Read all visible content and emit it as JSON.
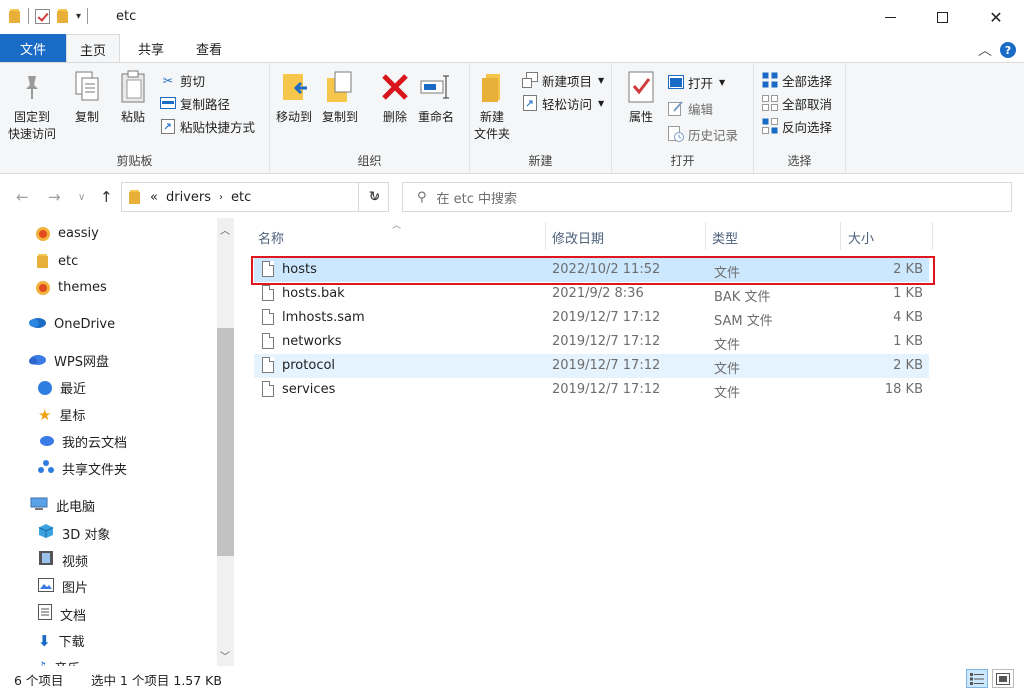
{
  "window": {
    "title": "etc"
  },
  "tabs": {
    "file": "文件",
    "home": "主页",
    "share": "共享",
    "view": "查看"
  },
  "ribbon": {
    "clipboard": {
      "label": "剪贴板",
      "pin": "固定到\n快速访问",
      "pin_l1": "固定到",
      "pin_l2": "快速访问",
      "copy": "复制",
      "paste": "粘贴",
      "cut": "剪切",
      "copy_path": "复制路径",
      "paste_shortcut": "粘贴快捷方式"
    },
    "organize": {
      "label": "组织",
      "move_to": "移动到",
      "copy_to": "复制到",
      "delete": "删除",
      "rename": "重命名"
    },
    "new": {
      "label": "新建",
      "new_folder_l1": "新建",
      "new_folder_l2": "文件夹",
      "new_item": "新建项目",
      "easy_access": "轻松访问"
    },
    "open": {
      "label": "打开",
      "properties": "属性",
      "open": "打开",
      "edit": "编辑",
      "history": "历史记录"
    },
    "select": {
      "label": "选择",
      "select_all": "全部选择",
      "select_none": "全部取消",
      "invert": "反向选择"
    }
  },
  "address": {
    "prefix": "«",
    "segments": [
      "drivers",
      "etc"
    ],
    "search_placeholder": "在 etc 中搜索"
  },
  "nav": {
    "items": [
      {
        "label": "eassiy"
      },
      {
        "label": "etc"
      },
      {
        "label": "themes"
      },
      {
        "label": "OneDrive"
      },
      {
        "label": "WPS网盘"
      },
      {
        "label": "最近"
      },
      {
        "label": "星标"
      },
      {
        "label": "我的云文档"
      },
      {
        "label": "共享文件夹"
      },
      {
        "label": "此电脑"
      },
      {
        "label": "3D 对象"
      },
      {
        "label": "视频"
      },
      {
        "label": "图片"
      },
      {
        "label": "文档"
      },
      {
        "label": "下载"
      },
      {
        "label": "音乐"
      }
    ]
  },
  "columns": {
    "name": "名称",
    "date": "修改日期",
    "type": "类型",
    "size": "大小"
  },
  "files": [
    {
      "name": "hosts",
      "date": "2022/10/2 11:52",
      "type": "文件",
      "size": "2 KB"
    },
    {
      "name": "hosts.bak",
      "date": "2021/9/2 8:36",
      "type": "BAK 文件",
      "size": "1 KB"
    },
    {
      "name": "lmhosts.sam",
      "date": "2019/12/7 17:12",
      "type": "SAM 文件",
      "size": "4 KB"
    },
    {
      "name": "networks",
      "date": "2019/12/7 17:12",
      "type": "文件",
      "size": "1 KB"
    },
    {
      "name": "protocol",
      "date": "2019/12/7 17:12",
      "type": "文件",
      "size": "2 KB"
    },
    {
      "name": "services",
      "date": "2019/12/7 17:12",
      "type": "文件",
      "size": "18 KB"
    }
  ],
  "status": {
    "count": "6 个项目",
    "selection": "选中 1 个项目  1.57 KB"
  },
  "colors": {
    "accent": "#1a6bc5",
    "selection": "#cce8ff",
    "highlight_box": "#e0161e"
  }
}
